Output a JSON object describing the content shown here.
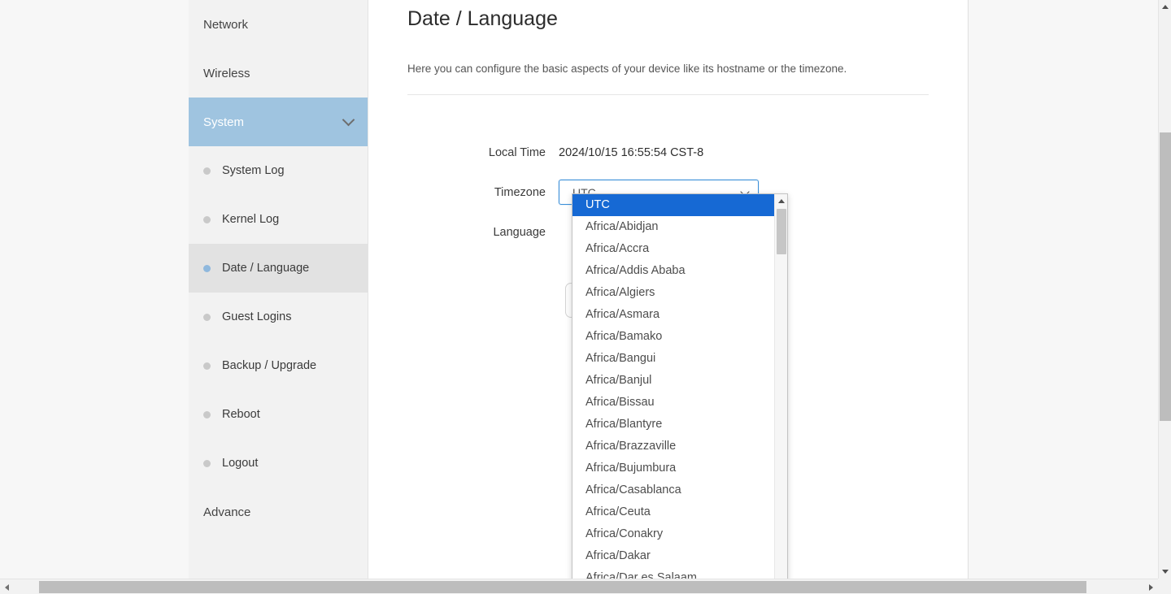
{
  "sidebar": {
    "items": [
      {
        "label": "Network",
        "type": "top",
        "state": "normal"
      },
      {
        "label": "Wireless",
        "type": "top",
        "state": "normal"
      },
      {
        "label": "System",
        "type": "top",
        "state": "expanded",
        "icon": "chevron-down-icon"
      },
      {
        "label": "System Log",
        "type": "child",
        "state": "normal"
      },
      {
        "label": "Kernel Log",
        "type": "child",
        "state": "normal"
      },
      {
        "label": "Date / Language",
        "type": "child",
        "state": "active"
      },
      {
        "label": "Guest Logins",
        "type": "child",
        "state": "normal"
      },
      {
        "label": "Backup / Upgrade",
        "type": "child",
        "state": "normal"
      },
      {
        "label": "Reboot",
        "type": "child",
        "state": "normal"
      },
      {
        "label": "Logout",
        "type": "child",
        "state": "normal"
      },
      {
        "label": "Advance",
        "type": "top",
        "state": "normal"
      }
    ],
    "colors": {
      "expanded_bg": "#9fc4e0",
      "active_bg": "#e2e2e2",
      "active_bullet": "#8fb8dd",
      "bullet": "#c9c9c9",
      "panel_bg": "#f2f2f2"
    }
  },
  "content": {
    "title": "Date / Language",
    "description": "Here you can configure the basic aspects of your device like its hostname or the timezone.",
    "form": {
      "local_time_label": "Local Time",
      "local_time_value": "2024/10/15 16:55:54 CST-8",
      "timezone_label": "Timezone",
      "timezone_value": "UTC",
      "language_label": "Language"
    }
  },
  "dropdown": {
    "open": true,
    "selected": "UTC",
    "selected_bg": "#1669d4",
    "selected_fg": "#ffffff",
    "options": [
      "UTC",
      "Africa/Abidjan",
      "Africa/Accra",
      "Africa/Addis Ababa",
      "Africa/Algiers",
      "Africa/Asmara",
      "Africa/Bamako",
      "Africa/Bangui",
      "Africa/Banjul",
      "Africa/Bissau",
      "Africa/Blantyre",
      "Africa/Brazzaville",
      "Africa/Bujumbura",
      "Africa/Casablanca",
      "Africa/Ceuta",
      "Africa/Conakry",
      "Africa/Dakar",
      "Africa/Dar es Salaam"
    ],
    "scrollbar": {
      "up_icon": "triangle-up-icon",
      "down_icon": "triangle-down-icon"
    }
  },
  "browser_scrollbars": {
    "vertical": {
      "up_icon": "triangle-up-icon",
      "down_icon": "triangle-down-icon"
    },
    "horizontal": {
      "left_icon": "triangle-left-icon",
      "right_icon": "triangle-right-icon"
    }
  }
}
